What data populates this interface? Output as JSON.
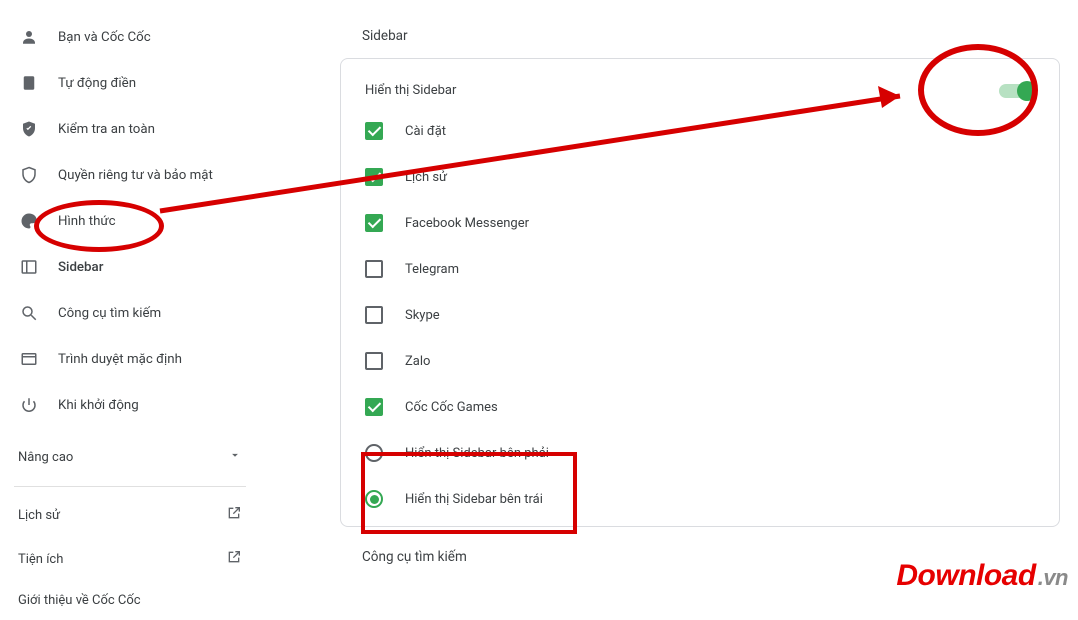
{
  "sidebar": {
    "items": [
      {
        "label": "Bạn và Cốc Cốc",
        "icon": "user"
      },
      {
        "label": "Tự động điền",
        "icon": "clipboard"
      },
      {
        "label": "Kiểm tra an toàn",
        "icon": "shield-check"
      },
      {
        "label": "Quyền riêng tư và bảo mật",
        "icon": "shield"
      },
      {
        "label": "Hình thức",
        "icon": "palette"
      },
      {
        "label": "Sidebar",
        "icon": "sidebar",
        "active": true
      },
      {
        "label": "Công cụ tìm kiếm",
        "icon": "search"
      },
      {
        "label": "Trình duyệt mặc định",
        "icon": "browser"
      },
      {
        "label": "Khi khởi động",
        "icon": "power"
      }
    ],
    "advanced_label": "Nâng cao",
    "links": [
      {
        "label": "Lịch sử"
      },
      {
        "label": "Tiện ích"
      }
    ],
    "about_label": "Giới thiệu về Cốc Cốc"
  },
  "main": {
    "section_title": "Sidebar",
    "panel_title": "Hiển thị Sidebar",
    "toggle_on": true,
    "options": [
      {
        "label": "Cài đặt",
        "checked": true
      },
      {
        "label": "Lịch sử",
        "checked": true
      },
      {
        "label": "Facebook Messenger",
        "checked": true
      },
      {
        "label": "Telegram",
        "checked": false
      },
      {
        "label": "Skype",
        "checked": false
      },
      {
        "label": "Zalo",
        "checked": false
      },
      {
        "label": "Cốc Cốc Games",
        "checked": true
      }
    ],
    "radios": [
      {
        "label": "Hiển thị Sidebar bên phải",
        "selected": false
      },
      {
        "label": "Hiển thị Sidebar bên trái",
        "selected": true
      }
    ],
    "next_section_title": "Công cụ tìm kiếm"
  },
  "annotation_colors": {
    "red": "#d60000"
  },
  "watermark": {
    "brand": "Download",
    "domain": ".vn"
  }
}
